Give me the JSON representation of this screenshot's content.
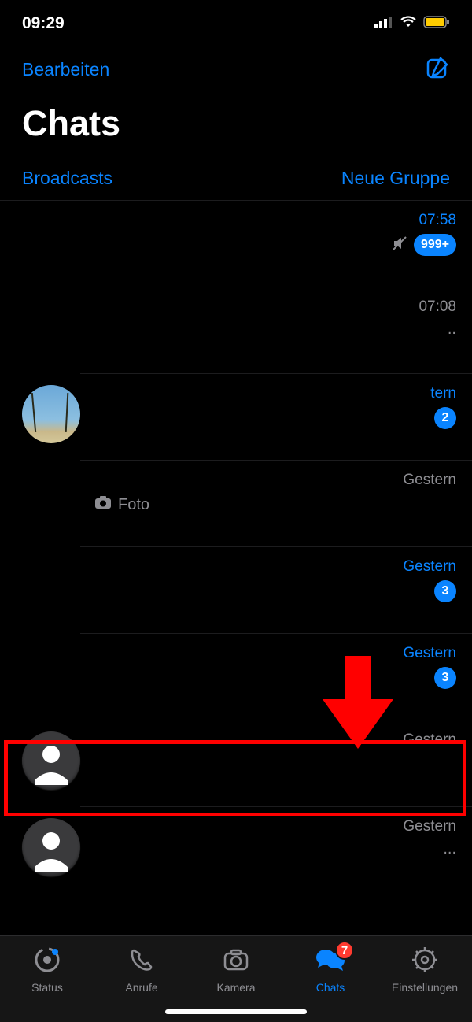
{
  "status": {
    "time": "09:29"
  },
  "header": {
    "edit": "Bearbeiten",
    "title": "Chats"
  },
  "subactions": {
    "broadcasts": "Broadcasts",
    "new_group": "Neue Gruppe"
  },
  "chats": [
    {
      "time": "07:58",
      "unread": true,
      "muted": true,
      "badge": "999+"
    },
    {
      "time": "07:08",
      "unread": false,
      "ellipsis": ".."
    },
    {
      "time": "tern",
      "unread": true,
      "badge": "2",
      "avatar": "palm"
    },
    {
      "time": "Gestern",
      "unread": false,
      "preview_icon": "camera",
      "preview_text": "Foto"
    },
    {
      "time": "Gestern",
      "unread": true,
      "badge": "3"
    },
    {
      "time": "Gestern",
      "unread": true,
      "badge": "3"
    },
    {
      "time": "Gestern",
      "unread": false,
      "avatar": "default"
    },
    {
      "time": "Gestern",
      "unread": false,
      "avatar": "default",
      "ellipsis": "..."
    }
  ],
  "tabs": {
    "status": "Status",
    "calls": "Anrufe",
    "camera": "Kamera",
    "chats": "Chats",
    "settings": "Einstellungen",
    "chats_badge": "7"
  }
}
